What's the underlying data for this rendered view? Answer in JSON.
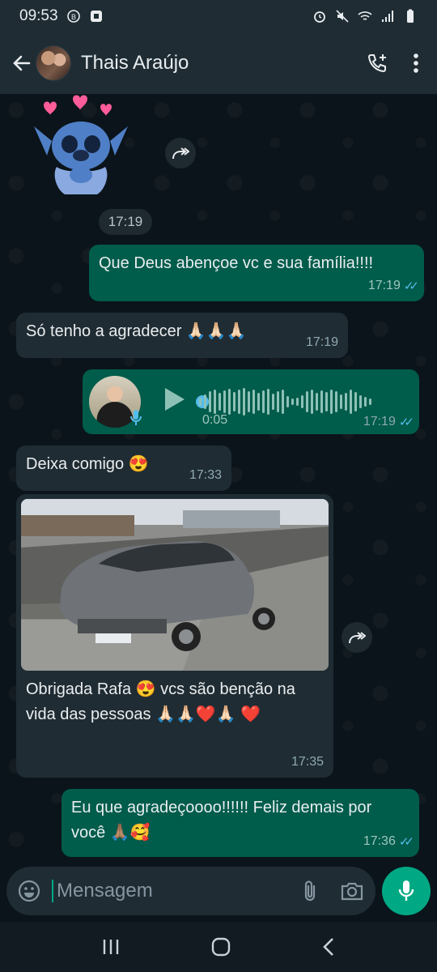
{
  "status_bar": {
    "time": "09:53"
  },
  "header": {
    "contact_name": "Thais Araújo"
  },
  "messages": {
    "sticker_time": "17:19",
    "m1": {
      "text": "Que Deus abençoe vc e sua família!!!!",
      "time": "17:19"
    },
    "m2": {
      "text": "Só tenho a agradecer 🙏🏻🙏🏻🙏🏻",
      "time": "17:19"
    },
    "voice": {
      "duration": "0:05",
      "time": "17:19"
    },
    "m3": {
      "text": "Deixa comigo 😍",
      "time": "17:33"
    },
    "m4": {
      "text": "Obrigada Rafa 😍 vcs são benção na vida das pessoas 🙏🏻🙏🏻❤️🙏🏻 ❤️",
      "time": "17:35"
    },
    "m5": {
      "text": "Eu que agradeçoooo!!!!!! Feliz demais por você 🙏🏽🥰",
      "time": "17:36"
    }
  },
  "input": {
    "placeholder": "Mensagem"
  },
  "colors": {
    "header": "#1f2c34",
    "outgoing": "#005c4b",
    "incoming": "#202c33",
    "accent": "#00a884",
    "read_ticks": "#53bdeb"
  }
}
